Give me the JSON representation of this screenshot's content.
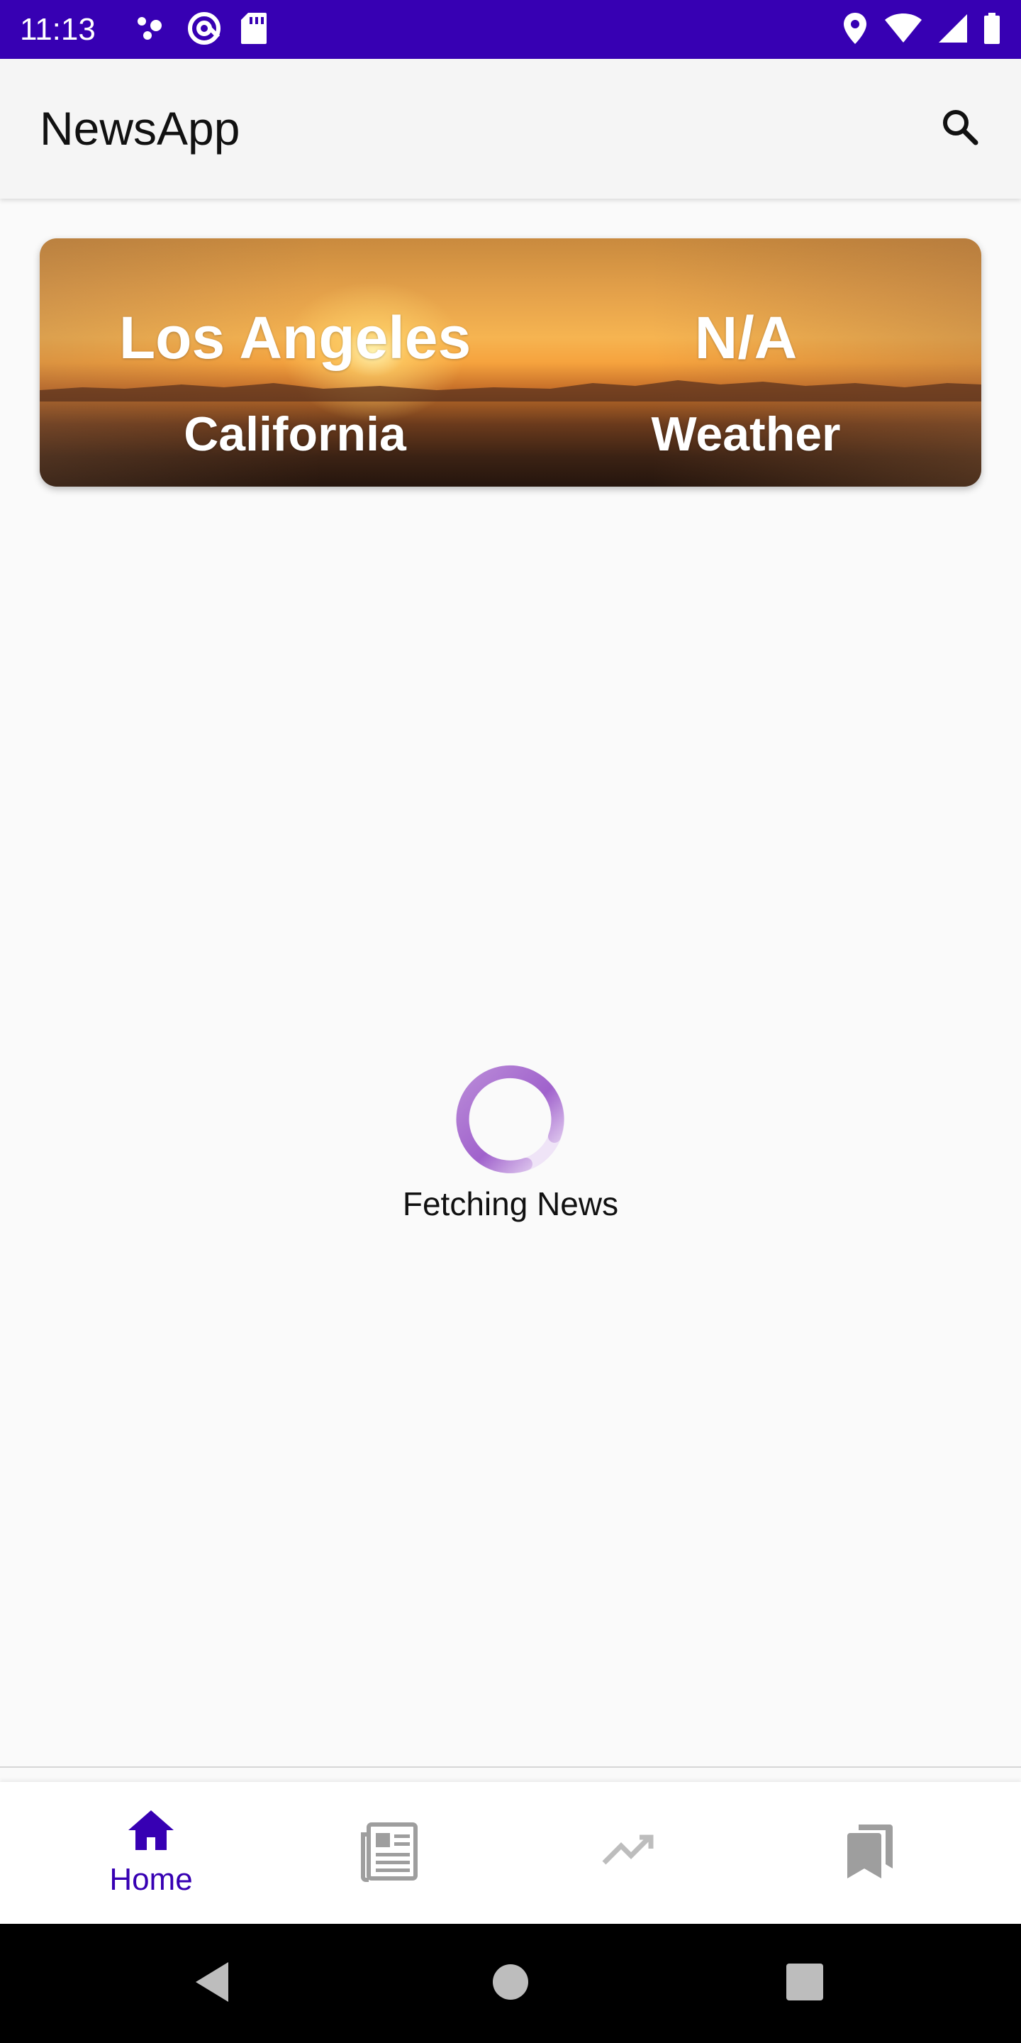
{
  "status_bar": {
    "time": "11:13",
    "left_icons": [
      "dots-icon",
      "at-sign-icon",
      "sd-card-icon"
    ],
    "right_icons": [
      "location-icon",
      "wifi-icon",
      "signal-icon",
      "battery-icon"
    ],
    "background": "#3700b3"
  },
  "app_bar": {
    "title": "NewsApp",
    "search_icon": "search-icon"
  },
  "weather_card": {
    "city": "Los Angeles",
    "state": "California",
    "temperature": "N/A",
    "label": "Weather"
  },
  "loading": {
    "text": "Fetching News",
    "spinner_color": "#a062cc"
  },
  "bottom_nav": {
    "items": [
      {
        "label": "Home",
        "icon": "home-icon",
        "selected": true
      },
      {
        "label": "",
        "icon": "newspaper-icon",
        "selected": false
      },
      {
        "label": "",
        "icon": "trending-icon",
        "selected": false
      },
      {
        "label": "",
        "icon": "bookmarks-icon",
        "selected": false
      }
    ],
    "accent": "#3700b3",
    "inactive": "#9e9e9e"
  },
  "system_nav": {
    "buttons": [
      "back-icon",
      "home-circle-icon",
      "recents-icon"
    ]
  }
}
